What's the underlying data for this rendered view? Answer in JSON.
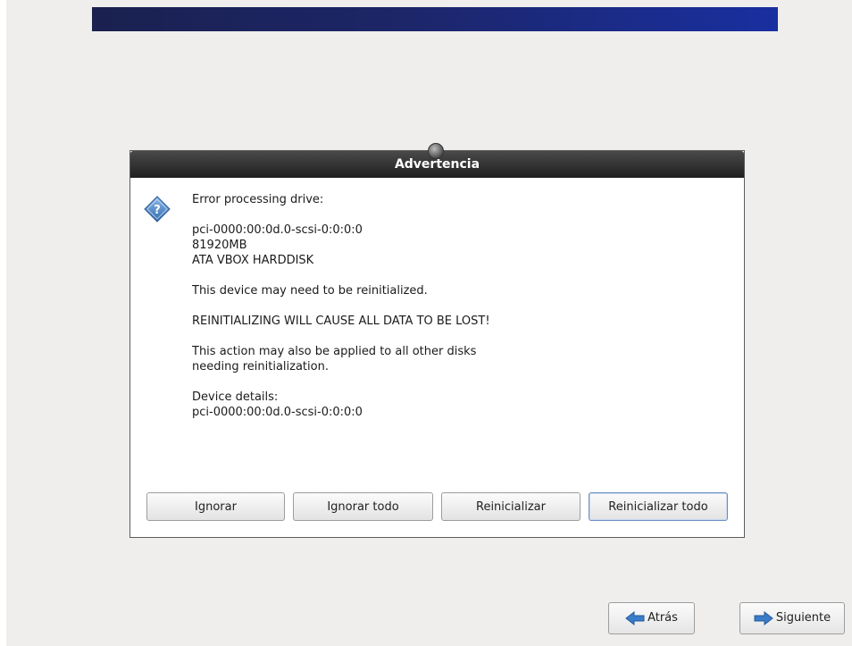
{
  "dialog": {
    "title": "Advertencia",
    "heading": "Error processing drive:",
    "drive_path": "pci-0000:00:0d.0-scsi-0:0:0:0",
    "drive_size": "81920MB",
    "drive_model": "ATA VBOX HARDDISK",
    "message_reinit": "This device may need to be reinitialized.",
    "warning_data_loss": "REINITIALIZING WILL CAUSE ALL DATA TO BE LOST!",
    "message_apply_line1": "This action may also be applied to all other disks",
    "message_apply_line2": "needing reinitialization.",
    "details_label": "Device details:",
    "details_value": "pci-0000:00:0d.0-scsi-0:0:0:0",
    "icon": "question-diamond-icon",
    "buttons": {
      "ignore": "Ignorar",
      "ignore_all": "Ignorar todo",
      "reinit": "Reinicializar",
      "reinit_all": "Reinicializar todo"
    }
  },
  "navigation": {
    "back_label": "Atrás",
    "back_icon": "arrow-left-icon",
    "next_label": "Siguiente",
    "next_icon": "arrow-right-icon"
  },
  "colors": {
    "banner": "#1c2668",
    "titlebar": "#2b2b2b",
    "icon_blue": "#4d86c8",
    "background": "#efeeec"
  }
}
